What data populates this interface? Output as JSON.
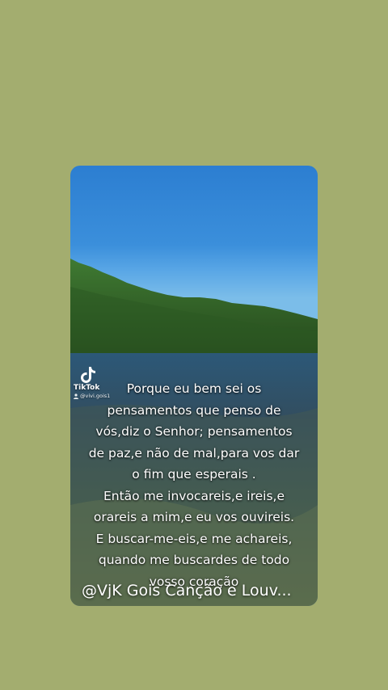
{
  "video": {
    "tiktok_brand": "TikTok",
    "tiktok_handle": "@vivi.gois1",
    "verse_lines": [
      "Porque eu bem sei os",
      "pensamentos que penso de",
      "vós,diz o Senhor; pensamentos",
      "de paz,e não de mal,para vos dar",
      "o fim que esperais .",
      "Então me invocareis,e ireis,e",
      "orareis a mim,e eu vos ouvireis.",
      "E  buscar-me-eis,e me achareis,",
      "quando me buscardes de todo",
      "vosso coração"
    ],
    "channel_caption": "@VjK Gois Canção e Louv..."
  },
  "colors": {
    "background": "#a3ad6f",
    "sky": "#3b8fdb",
    "water": "#2f4a5e",
    "forest": "#2f5a22"
  }
}
